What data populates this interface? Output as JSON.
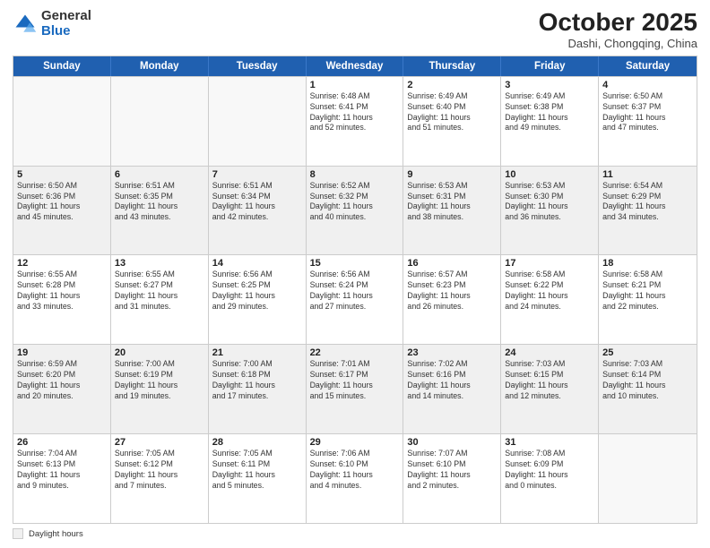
{
  "logo": {
    "general": "General",
    "blue": "Blue"
  },
  "title": "October 2025",
  "location": "Dashi, Chongqing, China",
  "weekdays": [
    "Sunday",
    "Monday",
    "Tuesday",
    "Wednesday",
    "Thursday",
    "Friday",
    "Saturday"
  ],
  "weeks": [
    [
      {
        "day": "",
        "info": ""
      },
      {
        "day": "",
        "info": ""
      },
      {
        "day": "",
        "info": ""
      },
      {
        "day": "1",
        "info": "Sunrise: 6:48 AM\nSunset: 6:41 PM\nDaylight: 11 hours\nand 52 minutes."
      },
      {
        "day": "2",
        "info": "Sunrise: 6:49 AM\nSunset: 6:40 PM\nDaylight: 11 hours\nand 51 minutes."
      },
      {
        "day": "3",
        "info": "Sunrise: 6:49 AM\nSunset: 6:38 PM\nDaylight: 11 hours\nand 49 minutes."
      },
      {
        "day": "4",
        "info": "Sunrise: 6:50 AM\nSunset: 6:37 PM\nDaylight: 11 hours\nand 47 minutes."
      }
    ],
    [
      {
        "day": "5",
        "info": "Sunrise: 6:50 AM\nSunset: 6:36 PM\nDaylight: 11 hours\nand 45 minutes."
      },
      {
        "day": "6",
        "info": "Sunrise: 6:51 AM\nSunset: 6:35 PM\nDaylight: 11 hours\nand 43 minutes."
      },
      {
        "day": "7",
        "info": "Sunrise: 6:51 AM\nSunset: 6:34 PM\nDaylight: 11 hours\nand 42 minutes."
      },
      {
        "day": "8",
        "info": "Sunrise: 6:52 AM\nSunset: 6:32 PM\nDaylight: 11 hours\nand 40 minutes."
      },
      {
        "day": "9",
        "info": "Sunrise: 6:53 AM\nSunset: 6:31 PM\nDaylight: 11 hours\nand 38 minutes."
      },
      {
        "day": "10",
        "info": "Sunrise: 6:53 AM\nSunset: 6:30 PM\nDaylight: 11 hours\nand 36 minutes."
      },
      {
        "day": "11",
        "info": "Sunrise: 6:54 AM\nSunset: 6:29 PM\nDaylight: 11 hours\nand 34 minutes."
      }
    ],
    [
      {
        "day": "12",
        "info": "Sunrise: 6:55 AM\nSunset: 6:28 PM\nDaylight: 11 hours\nand 33 minutes."
      },
      {
        "day": "13",
        "info": "Sunrise: 6:55 AM\nSunset: 6:27 PM\nDaylight: 11 hours\nand 31 minutes."
      },
      {
        "day": "14",
        "info": "Sunrise: 6:56 AM\nSunset: 6:25 PM\nDaylight: 11 hours\nand 29 minutes."
      },
      {
        "day": "15",
        "info": "Sunrise: 6:56 AM\nSunset: 6:24 PM\nDaylight: 11 hours\nand 27 minutes."
      },
      {
        "day": "16",
        "info": "Sunrise: 6:57 AM\nSunset: 6:23 PM\nDaylight: 11 hours\nand 26 minutes."
      },
      {
        "day": "17",
        "info": "Sunrise: 6:58 AM\nSunset: 6:22 PM\nDaylight: 11 hours\nand 24 minutes."
      },
      {
        "day": "18",
        "info": "Sunrise: 6:58 AM\nSunset: 6:21 PM\nDaylight: 11 hours\nand 22 minutes."
      }
    ],
    [
      {
        "day": "19",
        "info": "Sunrise: 6:59 AM\nSunset: 6:20 PM\nDaylight: 11 hours\nand 20 minutes."
      },
      {
        "day": "20",
        "info": "Sunrise: 7:00 AM\nSunset: 6:19 PM\nDaylight: 11 hours\nand 19 minutes."
      },
      {
        "day": "21",
        "info": "Sunrise: 7:00 AM\nSunset: 6:18 PM\nDaylight: 11 hours\nand 17 minutes."
      },
      {
        "day": "22",
        "info": "Sunrise: 7:01 AM\nSunset: 6:17 PM\nDaylight: 11 hours\nand 15 minutes."
      },
      {
        "day": "23",
        "info": "Sunrise: 7:02 AM\nSunset: 6:16 PM\nDaylight: 11 hours\nand 14 minutes."
      },
      {
        "day": "24",
        "info": "Sunrise: 7:03 AM\nSunset: 6:15 PM\nDaylight: 11 hours\nand 12 minutes."
      },
      {
        "day": "25",
        "info": "Sunrise: 7:03 AM\nSunset: 6:14 PM\nDaylight: 11 hours\nand 10 minutes."
      }
    ],
    [
      {
        "day": "26",
        "info": "Sunrise: 7:04 AM\nSunset: 6:13 PM\nDaylight: 11 hours\nand 9 minutes."
      },
      {
        "day": "27",
        "info": "Sunrise: 7:05 AM\nSunset: 6:12 PM\nDaylight: 11 hours\nand 7 minutes."
      },
      {
        "day": "28",
        "info": "Sunrise: 7:05 AM\nSunset: 6:11 PM\nDaylight: 11 hours\nand 5 minutes."
      },
      {
        "day": "29",
        "info": "Sunrise: 7:06 AM\nSunset: 6:10 PM\nDaylight: 11 hours\nand 4 minutes."
      },
      {
        "day": "30",
        "info": "Sunrise: 7:07 AM\nSunset: 6:10 PM\nDaylight: 11 hours\nand 2 minutes."
      },
      {
        "day": "31",
        "info": "Sunrise: 7:08 AM\nSunset: 6:09 PM\nDaylight: 11 hours\nand 0 minutes."
      },
      {
        "day": "",
        "info": ""
      }
    ]
  ],
  "legend": {
    "box_label": "Daylight hours"
  }
}
